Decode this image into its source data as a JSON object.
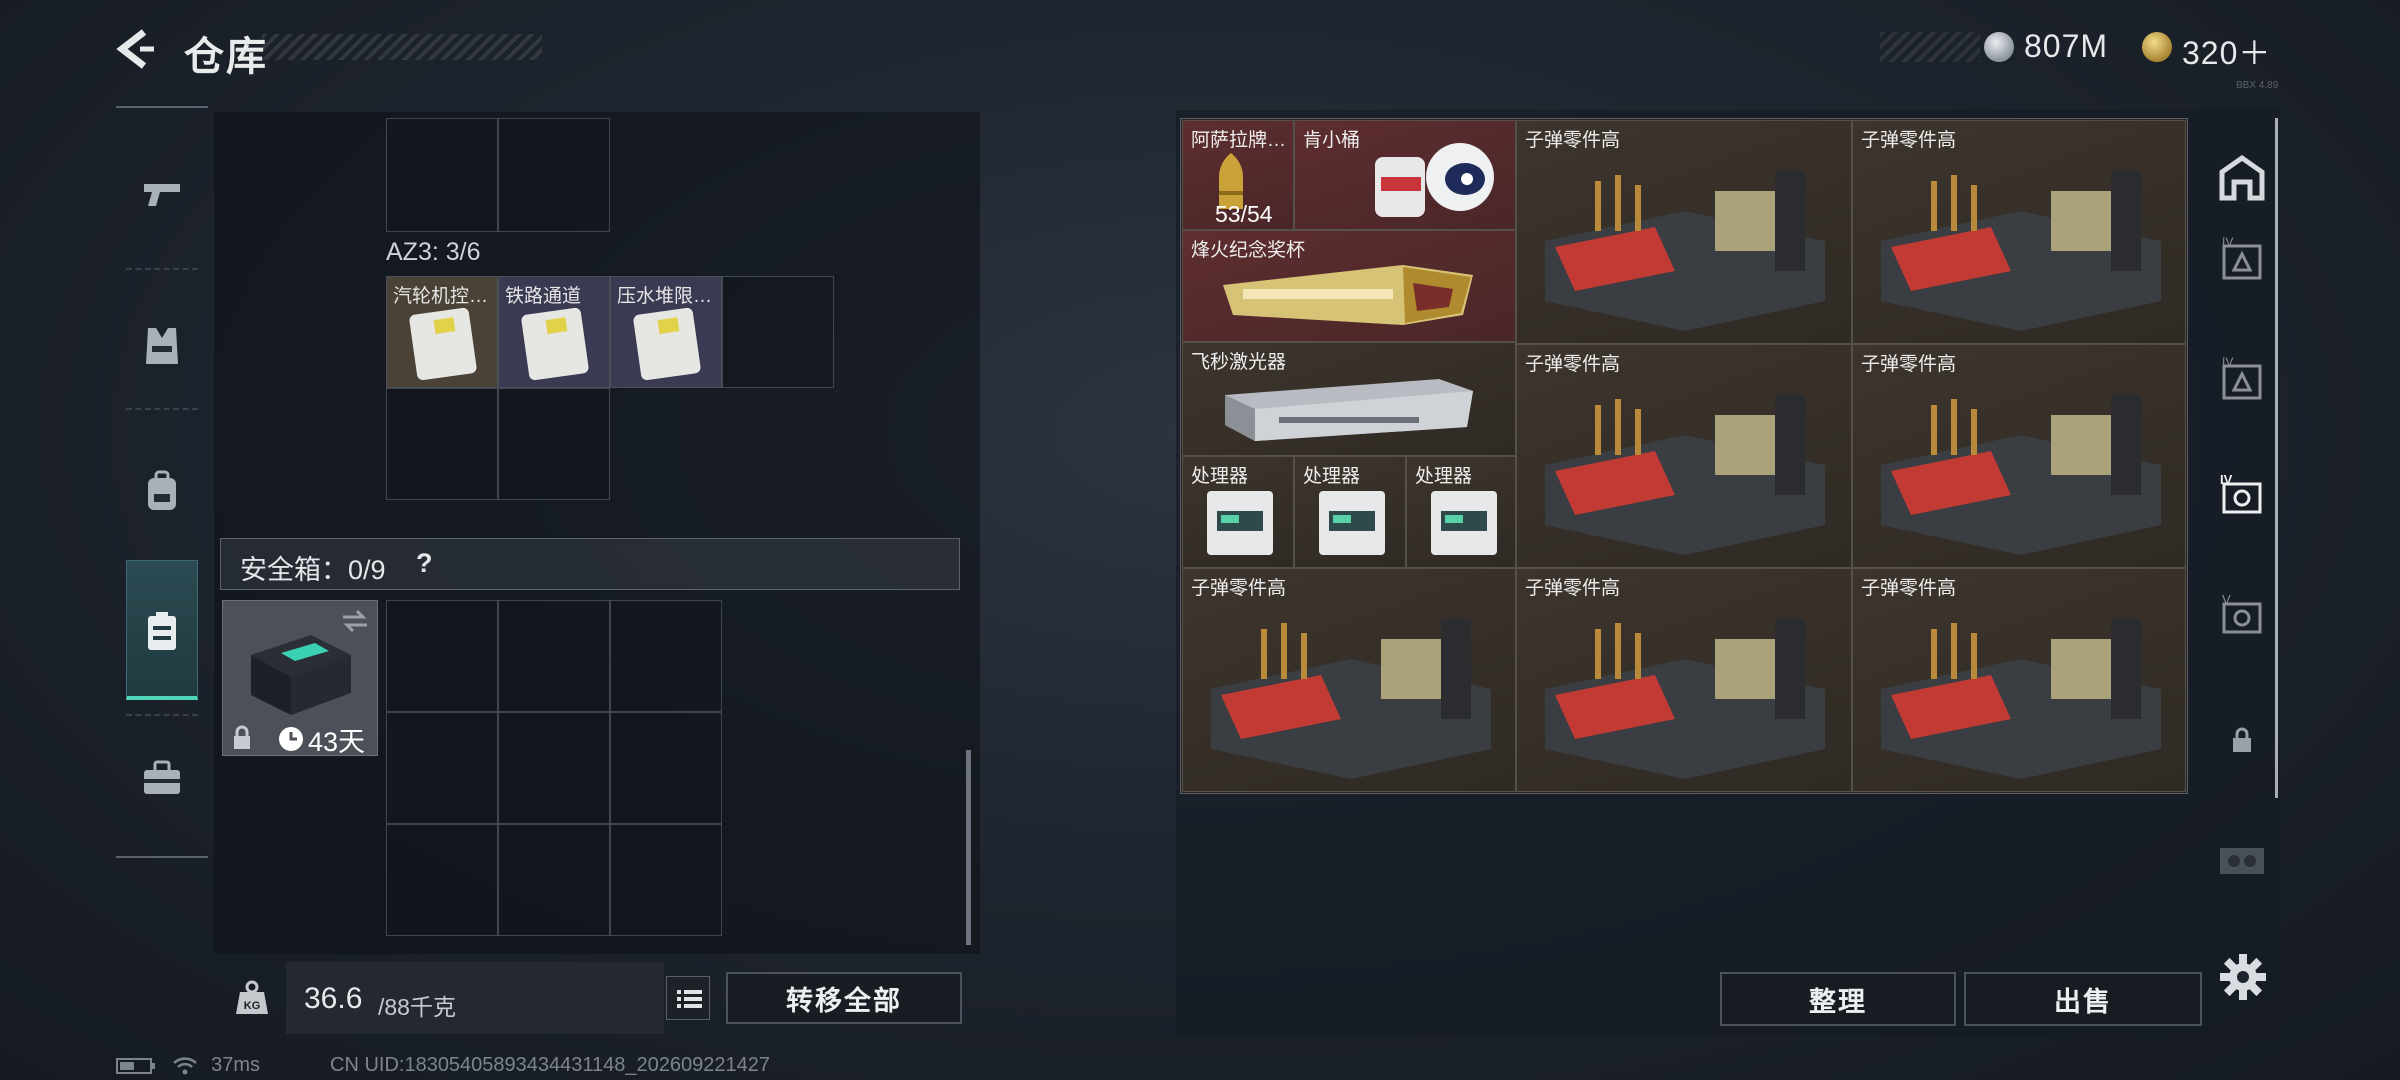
{
  "header": {
    "title": "仓库",
    "currencies": [
      {
        "icon": "silver-coin-icon",
        "value": "807M",
        "color": "#b9bec6"
      },
      {
        "icon": "gold-triangle-coin-icon",
        "value": "320＋",
        "color": "#d6b35a"
      }
    ],
    "corner_tag": "BBX 4.89"
  },
  "categories": [
    {
      "name": "weapons",
      "icon": "pistol-icon",
      "active": false
    },
    {
      "name": "vest",
      "icon": "vest-icon",
      "active": false
    },
    {
      "name": "backpack",
      "icon": "backpack-icon",
      "active": false
    },
    {
      "name": "container",
      "icon": "container-icon",
      "active": true
    },
    {
      "name": "toolbox",
      "icon": "toolbox-icon",
      "active": false
    }
  ],
  "container": {
    "az3_label": "AZ3: 3/6",
    "az3_items": [
      {
        "name": "汽轮机控…",
        "icon": "keycard-icon"
      },
      {
        "name": "铁路通道",
        "icon": "keycard-icon"
      },
      {
        "name": "压水堆限…",
        "icon": "keycard-icon"
      }
    ],
    "safebox_label": "安全箱：0/9",
    "safebox_help": "?",
    "safebox_days": "43天"
  },
  "weight": {
    "current": "36.6",
    "max": "/88千克"
  },
  "buttons": {
    "transfer_all": "转移全部",
    "sort": "整理",
    "sell": "出售"
  },
  "stash_items": [
    {
      "name": "阿萨拉牌…",
      "count": "53/54",
      "style": "red",
      "icon": "gold-cartridge-icon"
    },
    {
      "name": "肯小桶",
      "count": "",
      "style": "red",
      "icon": "white-helmet-figure-icon"
    },
    {
      "name": "烽火纪念奖杯",
      "count": "",
      "style": "red",
      "icon": "gold-trophy-icon"
    },
    {
      "name": "飞秒激光器",
      "count": "",
      "style": "brown",
      "icon": "laser-device-icon"
    },
    {
      "name": "处理器",
      "count": "",
      "style": "brown",
      "icon": "processor-icon"
    },
    {
      "name": "处理器",
      "count": "",
      "style": "brown",
      "icon": "processor-icon"
    },
    {
      "name": "处理器",
      "count": "",
      "style": "brown",
      "icon": "processor-icon"
    },
    {
      "name": "子弹零件高",
      "count": "",
      "style": "brown",
      "icon": "ammo-parts-crate-icon"
    },
    {
      "name": "子弹零件高",
      "count": "",
      "style": "brown",
      "icon": "ammo-parts-crate-icon"
    },
    {
      "name": "子弹零件高",
      "count": "",
      "style": "brown",
      "icon": "ammo-parts-crate-icon"
    },
    {
      "name": "子弹零件高",
      "count": "",
      "style": "brown",
      "icon": "ammo-parts-crate-icon"
    },
    {
      "name": "子弹零件高",
      "count": "",
      "style": "brown",
      "icon": "ammo-parts-crate-icon"
    },
    {
      "name": "子弹零件高",
      "count": "",
      "style": "brown",
      "icon": "ammo-parts-crate-icon"
    },
    {
      "name": "子弹零件高",
      "count": "",
      "style": "brown",
      "icon": "ammo-parts-crate-icon"
    }
  ],
  "stash_tabs": [
    {
      "label": "",
      "icon": "home-icon"
    },
    {
      "label": "IV",
      "icon": "level-4-case-icon"
    },
    {
      "label": "IV",
      "icon": "level-4-case-icon"
    },
    {
      "label": "IV",
      "icon": "level-4-safe-icon"
    },
    {
      "label": "V",
      "icon": "level-5-safe-icon"
    },
    {
      "label": "",
      "icon": "lock-icon"
    },
    {
      "label": "",
      "icon": "ticket-icon"
    }
  ],
  "status": {
    "ping": "37ms",
    "uid": "CN UID:18305405893434431148_202609221427"
  },
  "colors": {
    "accent": "#4fd6b8",
    "red_rarity": "#5e2e30",
    "brown_rarity": "#3d352d"
  }
}
